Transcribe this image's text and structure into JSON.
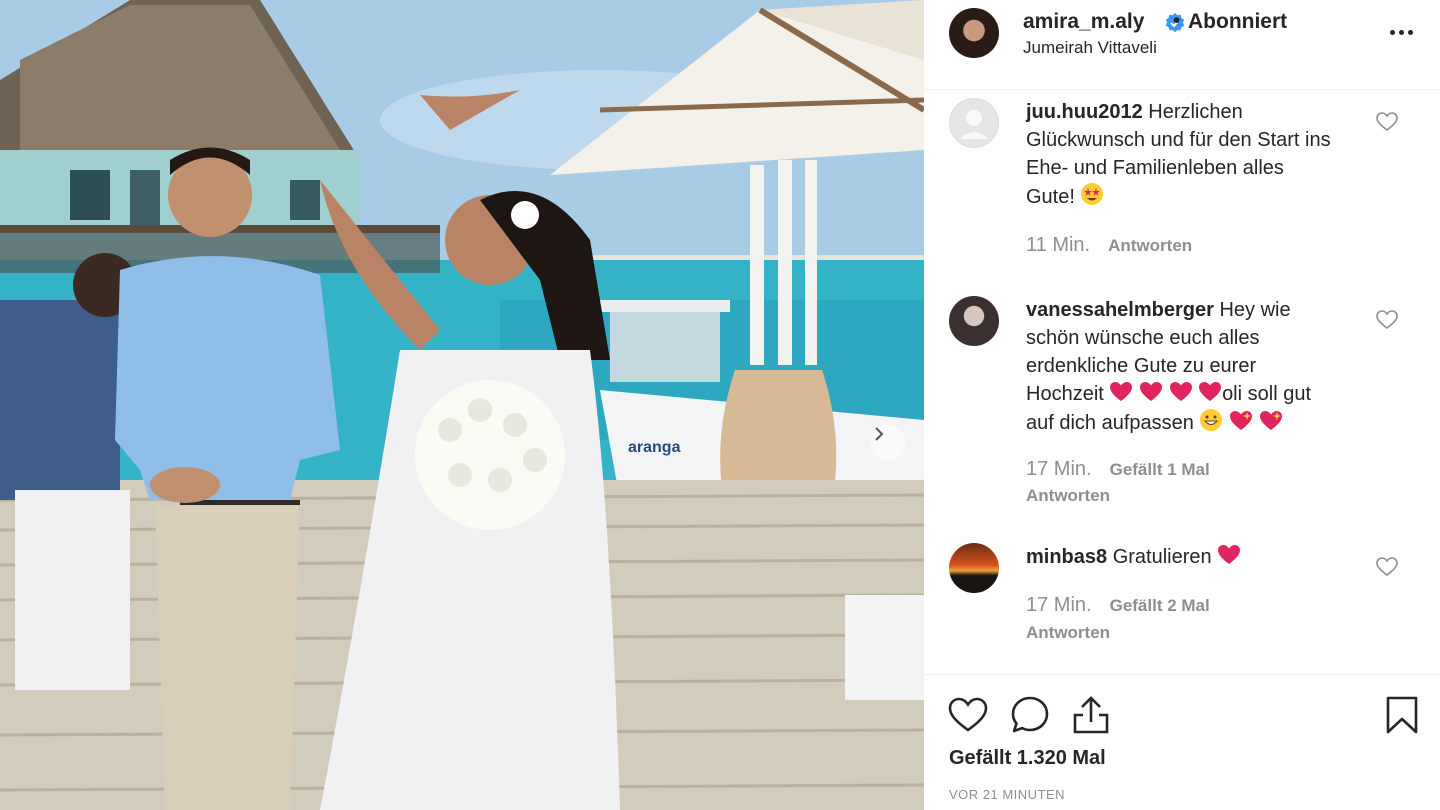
{
  "post": {
    "username": "amira_m.aly",
    "follow_status": "Abonniert",
    "separator": "•",
    "location": "Jumeirah Vittaveli",
    "photo_description_icon": "wedding-photo",
    "boat_name": "aranga"
  },
  "comments": [
    {
      "username": "juu.huu2012",
      "text_lines": [
        "Herzlichen",
        "Glückwunsch und für den Start ins",
        "Ehe- und Familienleben alles",
        "Gute! "
      ],
      "emoji": [
        "star-struck-emoji"
      ],
      "time": "11 Min.",
      "reply_label": "Antworten",
      "likes_label": ""
    },
    {
      "username": "vanessahelmberger",
      "text_lines": [
        "Hey wie",
        "schön wünsche euch alles",
        "erdenkliche Gute zu eurer",
        "Hochzeit",
        "oli soll gut",
        "auf dich aufpassen"
      ],
      "emoji": [
        "red-heart-emoji",
        "red-heart-emoji",
        "red-heart-emoji",
        "red-heart-emoji",
        "grinning-emoji",
        "sparkling-heart-emoji",
        "sparkling-heart-emoji"
      ],
      "time": "17 Min.",
      "likes_label": "Gefällt 1 Mal",
      "reply_label": "Antworten"
    },
    {
      "username": "minbas8",
      "text_lines": [
        "Gratulieren"
      ],
      "emoji": [
        "red-heart-emoji"
      ],
      "time": "17 Min.",
      "likes_label": "Gefällt 2 Mal",
      "reply_label": "Antworten"
    }
  ],
  "footer": {
    "likes": "Gefällt 1.320 Mal",
    "timestamp": "VOR 21 MINUTEN",
    "icons": [
      "heart-icon",
      "comment-icon",
      "share-icon",
      "bookmark-icon"
    ]
  },
  "colors": {
    "text": "#262626",
    "muted": "#8e8e8e",
    "verified": "#3897f0",
    "heart_emoji": "#e0245e"
  }
}
